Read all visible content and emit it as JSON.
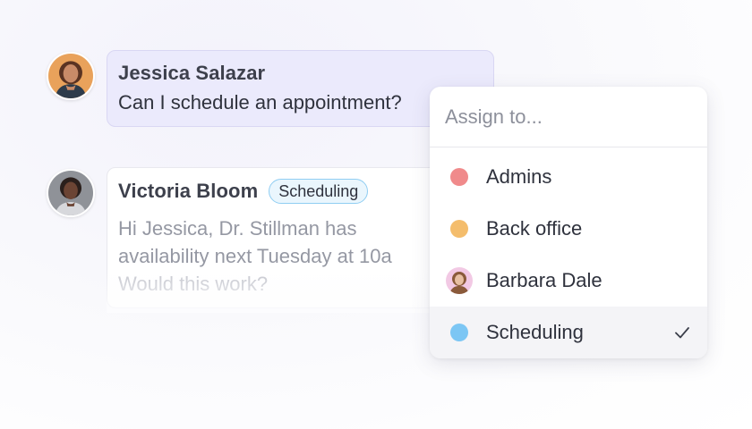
{
  "messages": [
    {
      "sender": "Jessica Salazar",
      "text": "Can I schedule an appointment?"
    },
    {
      "sender": "Victoria Bloom",
      "tag": "Scheduling",
      "lines": [
        "Hi Jessica, Dr. Stillman has",
        "availability next Tuesday at 10a",
        "Would this work?"
      ]
    }
  ],
  "assign_menu": {
    "placeholder": "Assign to...",
    "items": [
      {
        "label": "Admins",
        "icon": "dot",
        "color": "#f08a8b"
      },
      {
        "label": "Back office",
        "icon": "dot",
        "color": "#f4bd6c"
      },
      {
        "label": "Barbara Dale",
        "icon": "avatar",
        "color": "#f2c9e4"
      },
      {
        "label": "Scheduling",
        "icon": "dot",
        "color": "#7cc6f4",
        "selected": true
      }
    ]
  },
  "colors": {
    "incoming_bubble": "#ebeafc",
    "tag_border": "#8fcdf2",
    "tag_background": "#eaf6fd"
  }
}
